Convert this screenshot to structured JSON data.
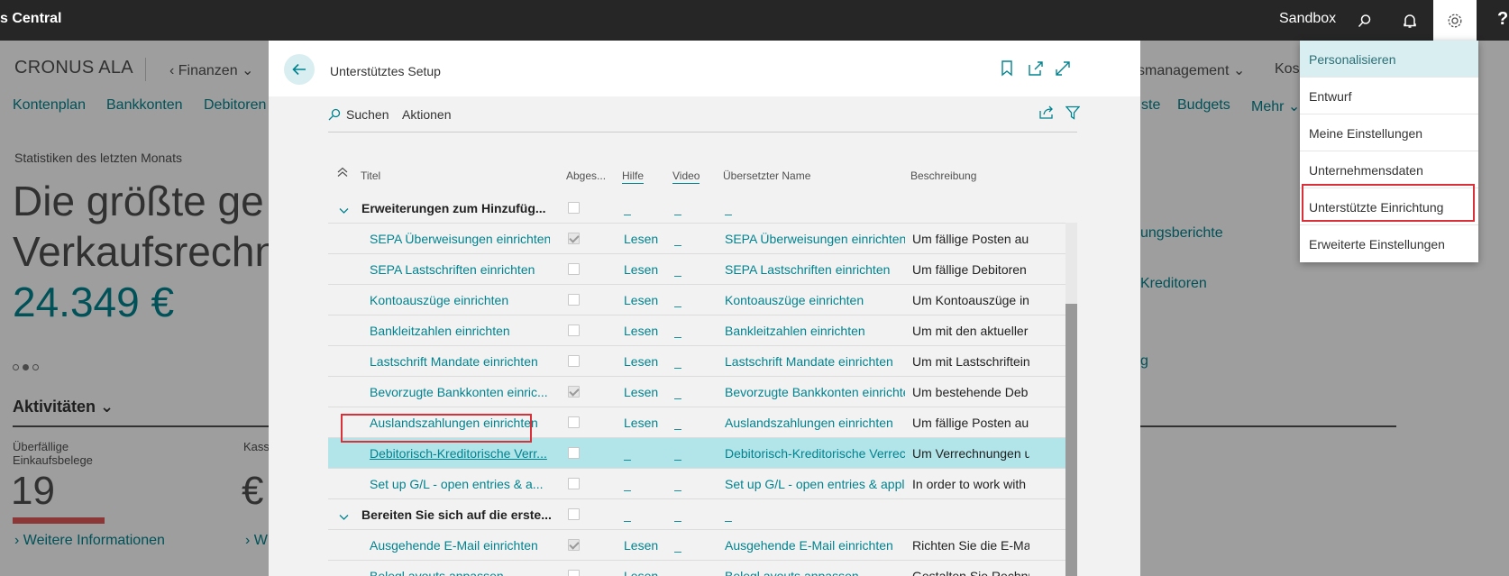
{
  "topbar": {
    "app_title": "s Central",
    "environment": "Sandbox",
    "help_label": "?"
  },
  "background": {
    "company": "CRONUS ALA",
    "nav_group": "Finanzen",
    "nav_group_right": "smanagement",
    "nav_group_right2": "Kos",
    "nav_links": [
      "Kontenplan",
      "Bankkonten",
      "Debitoren",
      "ste",
      "Budgets",
      "Mehr"
    ],
    "stat_caption": "Statistiken des letzten Monats",
    "hero_line1": "Die größte ge",
    "hero_line2": "Verkaufsrechn",
    "hero_value": "24.349 €",
    "activities": "Aktivitäten",
    "cue_label": "Überfällige Einkaufsbelege",
    "cue_value": "19",
    "more_info": "Weitere Informationen",
    "cue2_label": "Kass",
    "cue2_value": "€",
    "more_info2": "W",
    "right_links": [
      "ungsberichte",
      "Kreditoren",
      "g"
    ]
  },
  "dialog": {
    "title": "Unterstütztes Setup",
    "toolbar": {
      "search": "Suchen",
      "actions": "Aktionen"
    },
    "columns": {
      "title": "Titel",
      "completed": "Abges...",
      "help": "Hilfe",
      "video": "Video",
      "translated": "Übersetzter Name",
      "description": "Beschreibung"
    },
    "rows": [
      {
        "type": "group",
        "title": "Erweiterungen zum Hinzufüg...",
        "checked": false,
        "help": "_",
        "video": "_",
        "translated": "_",
        "description": ""
      },
      {
        "type": "item",
        "title": "SEPA Überweisungen einrichten",
        "checked": true,
        "help": "Lesen",
        "video": "_",
        "translated": "SEPA Überweisungen einrichten",
        "description": "Um fällige Posten au"
      },
      {
        "type": "item",
        "title": "SEPA Lastschriften einrichten",
        "checked": false,
        "help": "Lesen",
        "video": "_",
        "translated": "SEPA Lastschriften einrichten",
        "description": "Um fällige Debitoren"
      },
      {
        "type": "item",
        "title": "Kontoauszüge einrichten",
        "checked": false,
        "help": "Lesen",
        "video": "_",
        "translated": "Kontoauszüge einrichten",
        "description": "Um Kontoauszüge in"
      },
      {
        "type": "item",
        "title": "Bankleitzahlen einrichten",
        "checked": false,
        "help": "Lesen",
        "video": "_",
        "translated": "Bankleitzahlen einrichten",
        "description": "Um mit den aktueller"
      },
      {
        "type": "item",
        "title": "Lastschrift Mandate einrichten",
        "checked": false,
        "help": "Lesen",
        "video": "_",
        "translated": "Lastschrift Mandate einrichten",
        "description": "Um mit Lastschriftein"
      },
      {
        "type": "item",
        "title": "Bevorzugte Bankkonten einric...",
        "checked": true,
        "help": "Lesen",
        "video": "_",
        "translated": "Bevorzugte Bankkonten einrichten",
        "description": "Um bestehende Deb"
      },
      {
        "type": "item",
        "title": "Auslandszahlungen einrichten",
        "checked": false,
        "help": "Lesen",
        "video": "_",
        "translated": "Auslandszahlungen einrichten",
        "description": "Um fällige Posten au"
      },
      {
        "type": "item",
        "selected": true,
        "title": "Debitorisch-Kreditorische Verr...",
        "checked": false,
        "help": "_",
        "video": "_",
        "translated": "Debitorisch-Kreditorische Verrec...",
        "description": "Um Verrechnungen u"
      },
      {
        "type": "item",
        "title": "Set up G/L - open entries & a...",
        "checked": false,
        "help": "_",
        "video": "_",
        "translated": "Set up G/L - open entries & appli...",
        "description": "In order to work with"
      },
      {
        "type": "group",
        "title": "Bereiten Sie sich auf die erste...",
        "checked": false,
        "help": "_",
        "video": "_",
        "translated": "_",
        "description": ""
      },
      {
        "type": "item",
        "title": "Ausgehende E-Mail einrichten",
        "checked": true,
        "help": "Lesen",
        "video": "_",
        "translated": "Ausgehende E-Mail einrichten",
        "description": "Richten Sie die E-Ma"
      },
      {
        "type": "item",
        "title": "Belegl ayouts anpassen",
        "checked": false,
        "help": "Lesen",
        "video": "_",
        "translated": "Belegl ayouts anpassen",
        "description": "Gestalten Sie Rechnu"
      }
    ]
  },
  "settings_menu": {
    "items": [
      "Personalisieren",
      "Entwurf",
      "Meine Einstellungen",
      "Unternehmensdaten",
      "Unterstützte Einrichtung",
      "Erweiterte Einstellungen"
    ]
  },
  "colors": {
    "accent": "#00838f",
    "topbar": "#262626",
    "highlight": "#d9303a",
    "selected_row": "#b2e5ea"
  }
}
